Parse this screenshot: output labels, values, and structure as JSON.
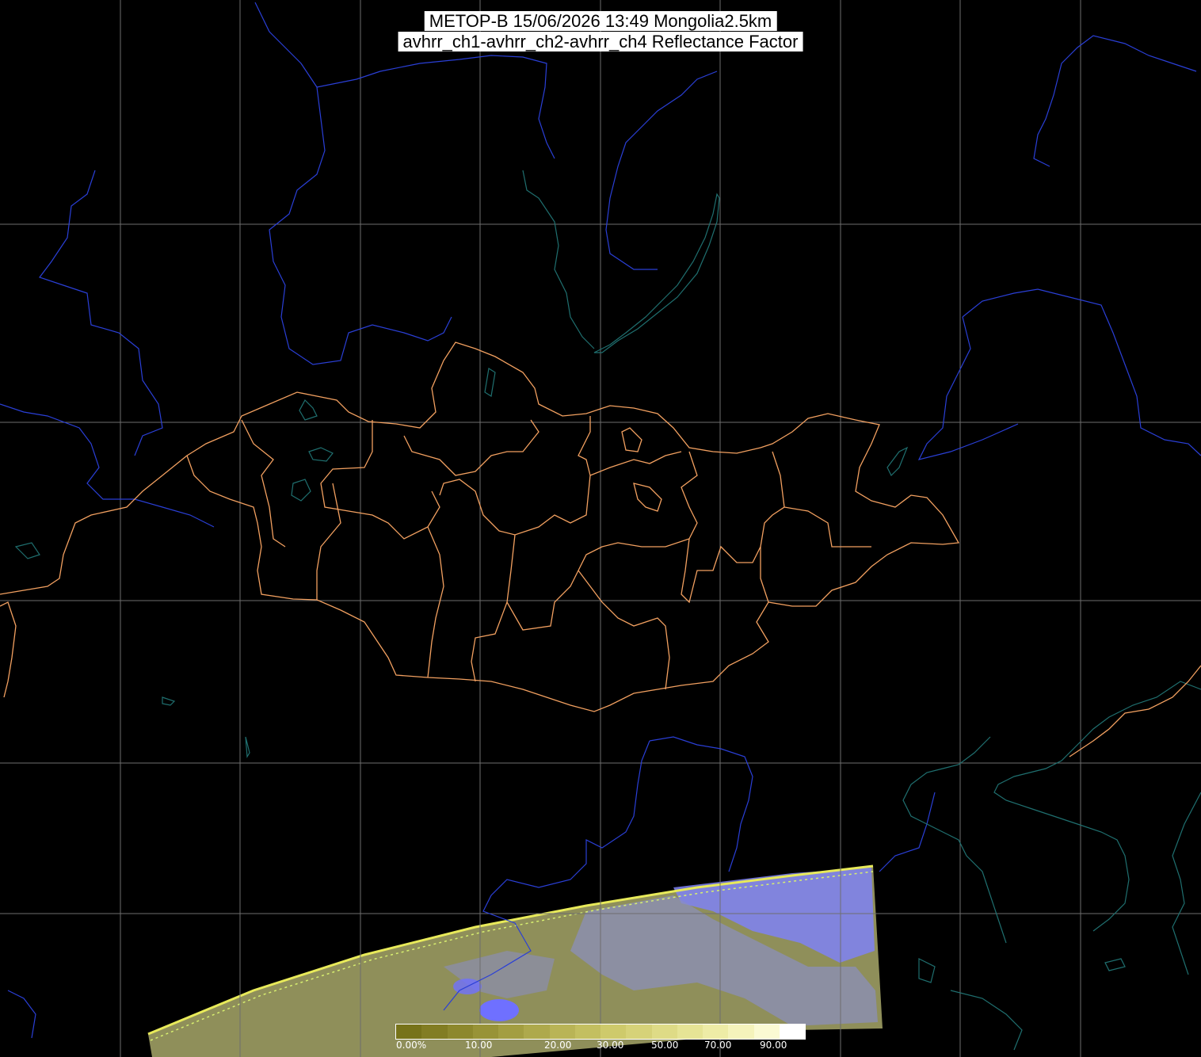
{
  "title": {
    "line1": "METOP-B 15/06/2026 13:49 Mongolia2.5km",
    "line2": "avhrr_ch1-avhrr_ch2-avhrr_ch4 Reflectance Factor"
  },
  "colors": {
    "background": "#000000",
    "grid": "#6e6e6e",
    "rivers": "#2a3fd6",
    "lakes_coast": "#1f6f6f",
    "boundaries": "#f2a060",
    "swath_base": "#8f8f5a",
    "cloud": "#7f83f5"
  },
  "legend": {
    "ticks": [
      "0.00%",
      "10.00",
      "20.00",
      "30.00",
      "50.00",
      "70.00",
      "90.00"
    ],
    "gradient": [
      "#77731a",
      "#827d23",
      "#8d882d",
      "#989337",
      "#a39e41",
      "#aea94c",
      "#b9b456",
      "#c3bf60",
      "#ceca6b",
      "#d6d278",
      "#dedb86",
      "#e6e495",
      "#eeeca6",
      "#f5f3bb",
      "#fbfad3",
      "#ffffff"
    ]
  }
}
